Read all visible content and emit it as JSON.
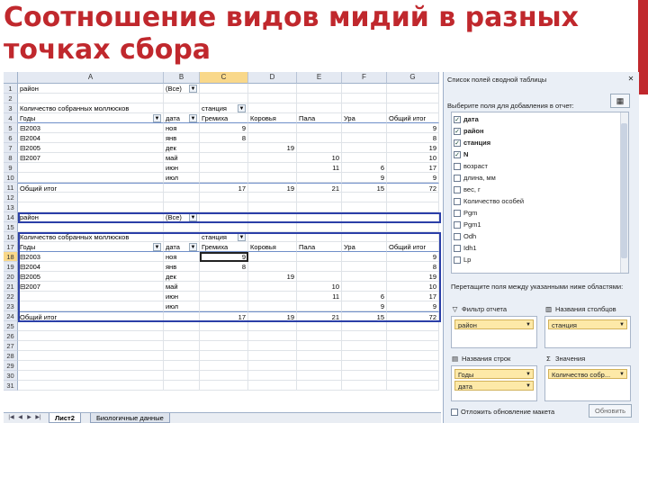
{
  "slide": {
    "title": "Соотношение видов мидий в разных точках сбора"
  },
  "colors": {
    "title": "#c0282d",
    "accent": "#c0282d",
    "pivot_border": "#2b3fa8"
  },
  "sheet": {
    "columns": [
      "A",
      "B",
      "C",
      "D",
      "E",
      "F",
      "G"
    ],
    "selected_column": "C",
    "selected_row": "18",
    "rows": [
      {
        "n": "1",
        "cells": [
          "район",
          "(Все)",
          "",
          "",
          "",
          "",
          ""
        ]
      },
      {
        "n": "2",
        "cells": [
          "",
          "",
          "",
          "",
          "",
          "",
          ""
        ]
      },
      {
        "n": "3",
        "cells": [
          "Количество собранных моллюсков",
          "",
          "станция",
          "",
          "",
          "",
          ""
        ]
      },
      {
        "n": "4",
        "cells": [
          "Годы",
          "дата",
          "Гремиха",
          "Коровья",
          "Пала",
          "Ура",
          "Общий итог"
        ]
      },
      {
        "n": "5",
        "cells": [
          "⊟2003",
          "ноя",
          "9",
          "",
          "",
          "",
          "9"
        ]
      },
      {
        "n": "6",
        "cells": [
          "⊟2004",
          "янв",
          "8",
          "",
          "",
          "",
          "8"
        ]
      },
      {
        "n": "7",
        "cells": [
          "⊟2005",
          "дек",
          "",
          "19",
          "",
          "",
          "19"
        ]
      },
      {
        "n": "8",
        "cells": [
          "⊟2007",
          "май",
          "",
          "",
          "10",
          "",
          "10"
        ]
      },
      {
        "n": "9",
        "cells": [
          "",
          "июн",
          "",
          "",
          "11",
          "6",
          "17"
        ]
      },
      {
        "n": "10",
        "cells": [
          "",
          "июл",
          "",
          "",
          "",
          "9",
          "9"
        ]
      },
      {
        "n": "11",
        "cells": [
          "Общий итог",
          "",
          "17",
          "19",
          "21",
          "15",
          "72"
        ]
      },
      {
        "n": "12",
        "cells": [
          "",
          "",
          "",
          "",
          "",
          "",
          ""
        ]
      },
      {
        "n": "13",
        "cells": [
          "",
          "",
          "",
          "",
          "",
          "",
          ""
        ]
      },
      {
        "n": "14",
        "cells": [
          "район",
          "(Все)",
          "",
          "",
          "",
          "",
          ""
        ]
      },
      {
        "n": "15",
        "cells": [
          "",
          "",
          "",
          "",
          "",
          "",
          ""
        ]
      },
      {
        "n": "16",
        "cells": [
          "Количество собранных моллюсков",
          "",
          "станция",
          "",
          "",
          "",
          ""
        ]
      },
      {
        "n": "17",
        "cells": [
          "Годы",
          "дата",
          "Гремиха",
          "Коровья",
          "Пала",
          "Ура",
          "Общий итог"
        ]
      },
      {
        "n": "18",
        "cells": [
          "⊟2003",
          "ноя",
          "9",
          "",
          "",
          "",
          "9"
        ]
      },
      {
        "n": "19",
        "cells": [
          "⊟2004",
          "янв",
          "8",
          "",
          "",
          "",
          "8"
        ]
      },
      {
        "n": "20",
        "cells": [
          "⊟2005",
          "дек",
          "",
          "19",
          "",
          "",
          "19"
        ]
      },
      {
        "n": "21",
        "cells": [
          "⊟2007",
          "май",
          "",
          "",
          "10",
          "",
          "10"
        ]
      },
      {
        "n": "22",
        "cells": [
          "",
          "июн",
          "",
          "",
          "11",
          "6",
          "17"
        ]
      },
      {
        "n": "23",
        "cells": [
          "",
          "июл",
          "",
          "",
          "",
          "9",
          "9"
        ]
      },
      {
        "n": "24",
        "cells": [
          "Общий итог",
          "",
          "17",
          "19",
          "21",
          "15",
          "72"
        ]
      },
      {
        "n": "25",
        "cells": [
          "",
          "",
          "",
          "",
          "",
          "",
          ""
        ]
      },
      {
        "n": "26",
        "cells": [
          "",
          "",
          "",
          "",
          "",
          "",
          ""
        ]
      },
      {
        "n": "27",
        "cells": [
          "",
          "",
          "",
          "",
          "",
          "",
          ""
        ]
      },
      {
        "n": "28",
        "cells": [
          "",
          "",
          "",
          "",
          "",
          "",
          ""
        ]
      },
      {
        "n": "29",
        "cells": [
          "",
          "",
          "",
          "",
          "",
          "",
          ""
        ]
      },
      {
        "n": "30",
        "cells": [
          "",
          "",
          "",
          "",
          "",
          "",
          ""
        ]
      },
      {
        "n": "31",
        "cells": [
          "",
          "",
          "",
          "",
          "",
          "",
          ""
        ]
      }
    ],
    "tabs": [
      "Лист2",
      "Биологичные данные"
    ],
    "active_tab": 0
  },
  "field_pane": {
    "title": "Список полей сводной таблицы",
    "choose_label": "Выберите поля для добавления в отчет:",
    "fields": [
      {
        "name": "дата",
        "checked": true
      },
      {
        "name": "район",
        "checked": true
      },
      {
        "name": "станция",
        "checked": true
      },
      {
        "name": "N",
        "checked": true
      },
      {
        "name": "возраст",
        "checked": false
      },
      {
        "name": "длина, мм",
        "checked": false
      },
      {
        "name": "вес, г",
        "checked": false
      },
      {
        "name": "Количество особей",
        "checked": false
      },
      {
        "name": "Pgm",
        "checked": false
      },
      {
        "name": "Pgm1",
        "checked": false
      },
      {
        "name": "Odh",
        "checked": false
      },
      {
        "name": "Idh1",
        "checked": false
      },
      {
        "name": "Lp",
        "checked": false
      }
    ],
    "drag_label": "Перетащите поля между указанными ниже областями:",
    "areas": {
      "report_filter": {
        "label": "Фильтр отчета",
        "items": [
          "район"
        ]
      },
      "column_labels": {
        "label": "Названия столбцов",
        "items": [
          "станция"
        ]
      },
      "row_labels": {
        "label": "Названия строк",
        "items": [
          "Годы",
          "дата"
        ]
      },
      "values": {
        "label": "Значения",
        "items": [
          "Количество собр..."
        ]
      }
    },
    "defer_label": "Отложить обновление макета",
    "update_label": "Обновить",
    "icons": {
      "filter": "filter-icon",
      "columns": "columns-icon",
      "rows": "rows-icon",
      "sigma": "sigma-icon"
    }
  }
}
